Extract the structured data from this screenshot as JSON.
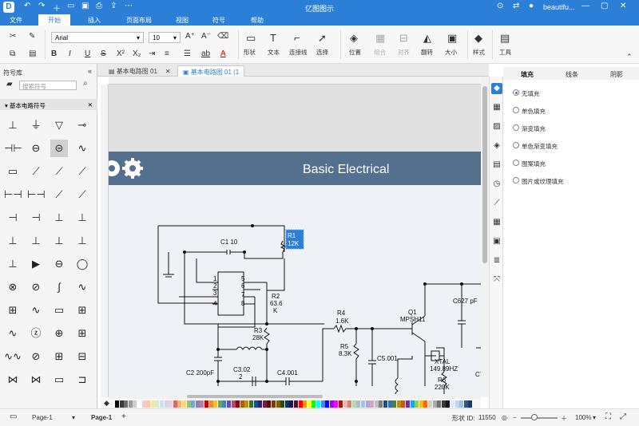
{
  "titlebar": {
    "app_title": "亿图图示",
    "user_name": "beautifu...",
    "logo_glyph": "D"
  },
  "menu": {
    "items": [
      "文件",
      "开始",
      "插入",
      "页面布局",
      "视图",
      "符号",
      "帮助"
    ],
    "active": "开始"
  },
  "ribbon": {
    "font_name": "Arial",
    "font_size": "10",
    "labels": {
      "shape": "形状",
      "text": "文本",
      "connector": "连接线",
      "select": "选择",
      "position": "位置",
      "group": "组合",
      "align": "对齐",
      "flip": "翻转",
      "size": "大小",
      "style": "样式",
      "tools": "工具"
    }
  },
  "left_panel": {
    "title": "符号库",
    "search_placeholder": "搜索符号",
    "section": "基本电路符号"
  },
  "tabs": [
    {
      "label": "基本电路图 01"
    },
    {
      "label": "基本电路图 01 (1"
    }
  ],
  "canvas": {
    "banner_title": "Basic Electrical"
  },
  "circuit": {
    "labels": {
      "c1": "C1  10",
      "r1a": "R1",
      "r1b": "12K",
      "r2a": "R2",
      "r2b": "63.6",
      "r2c": "K",
      "r3a": "R3",
      "r3b": "28K",
      "c2": "C2 200pF",
      "c3a": "C3.02",
      "c3b": "2",
      "c4": "C4.001",
      "r4a": "R4",
      "r4b": "1.6K",
      "r5a": "R5",
      "r5b": "8.3K",
      "c5": "C5.001",
      "q1a": "Q1",
      "q1b": "MPSH11",
      "c6": "C627 pF",
      "xtala": "XTAL",
      "xtalb": "149.89HZ",
      "r6a": "R6",
      "r6b": "220K",
      "c7": "C7",
      "p1": "1",
      "p2": "2",
      "p3": "3",
      "p4": "4",
      "p5": "5",
      "p6": "6",
      "p7": "7",
      "p8": "8"
    }
  },
  "right_panel": {
    "tabs": [
      "填充",
      "线条",
      "阴影"
    ],
    "options": [
      "无填充",
      "单色填充",
      "渐变填充",
      "单色渐变填充",
      "图案填充",
      "图片或纹理填充"
    ],
    "selected": "无填充"
  },
  "statusbar": {
    "page_dropdown": "Page-1",
    "page_tab": "Page-1",
    "add_page": "+",
    "shape_id_label": "形状 ID:",
    "shape_id": "11550",
    "zoom": "100%"
  },
  "colors": {
    "accent": "#2c7fd6",
    "banner": "#55708f",
    "palette": [
      "#000000",
      "#3b3b3b",
      "#6b6b6b",
      "#9b9b9b",
      "#cfcfcf",
      "#ffffff",
      "#f4cccc",
      "#f8c9a3",
      "#fce5a3",
      "#d9ead3",
      "#c9e2f3",
      "#d9d2e9",
      "#ead1dc",
      "#e06666",
      "#f6b26b",
      "#ffd966",
      "#93c47d",
      "#6fa8dc",
      "#8e7cc3",
      "#c27ba0",
      "#cc0000",
      "#e69138",
      "#f1c232",
      "#6aa84f",
      "#3d85c6",
      "#674ea7",
      "#a64d79",
      "#990000",
      "#b45f06",
      "#bf9000",
      "#38761d",
      "#0b5394",
      "#351c75",
      "#741b47",
      "#660000",
      "#783f04",
      "#7f6000",
      "#274e13",
      "#073763",
      "#20124d",
      "#4c1130",
      "#ff0000",
      "#ff9900",
      "#ffff00",
      "#00ff00",
      "#00ffff",
      "#4a86e8",
      "#0000ff",
      "#9900ff",
      "#ff00ff",
      "#a61c00",
      "#e6b8af",
      "#dd7e6b",
      "#b6d7a8",
      "#a2c4c9",
      "#9fc5e8",
      "#b4a7d6",
      "#d5a6bd",
      "#c0c0c0",
      "#808080",
      "#1f4e79",
      "#2e75b6",
      "#548235",
      "#bf8f00",
      "#c55a11",
      "#7030a0",
      "#00b0f0",
      "#92d050",
      "#ffc000",
      "#ff6600",
      "#d0cece",
      "#aeaaaa",
      "#757171",
      "#3a3838",
      "#171717",
      "#ddebf7",
      "#bdd7ee",
      "#9bc2e6",
      "#2f5597",
      "#203864"
    ]
  }
}
